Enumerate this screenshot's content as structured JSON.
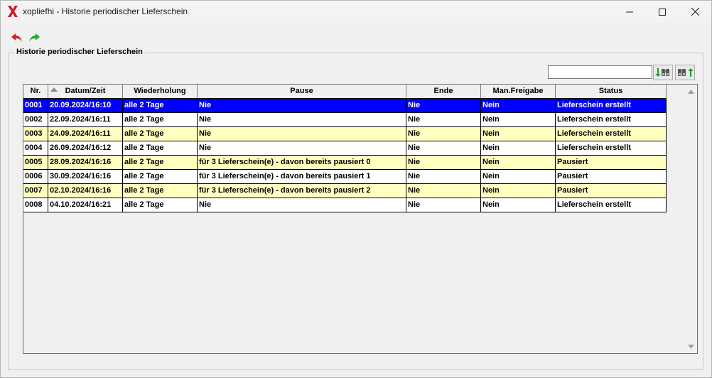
{
  "window": {
    "title": "xopliefhi - Historie periodischer Lieferschein"
  },
  "group": {
    "title": "Historie periodischer Lieferschein"
  },
  "search": {
    "value": "",
    "placeholder": ""
  },
  "table": {
    "headers": [
      "Nr.",
      "Datum/Zeit",
      "Wiederholung",
      "Pause",
      "Ende",
      "Man.Freigabe",
      "Status"
    ],
    "rows": [
      {
        "cells": [
          "0001",
          "20.09.2024/16:10",
          "alle 2 Tage",
          "Nie",
          "Nie",
          "Nein",
          "Lieferschein erstellt"
        ]
      },
      {
        "cells": [
          "0002",
          "22.09.2024/16:11",
          "alle 2 Tage",
          "Nie",
          "Nie",
          "Nein",
          "Lieferschein erstellt"
        ]
      },
      {
        "cells": [
          "0003",
          "24.09.2024/16:11",
          "alle 2 Tage",
          "Nie",
          "Nie",
          "Nein",
          "Lieferschein erstellt"
        ]
      },
      {
        "cells": [
          "0004",
          "26.09.2024/16:12",
          "alle 2 Tage",
          "Nie",
          "Nie",
          "Nein",
          "Lieferschein erstellt"
        ]
      },
      {
        "cells": [
          "0005",
          "28.09.2024/16:16",
          "alle 2 Tage",
          "für 3 Lieferschein(e) - davon bereits pausiert 0",
          "Nie",
          "Nein",
          "Pausiert"
        ]
      },
      {
        "cells": [
          "0006",
          "30.09.2024/16:16",
          "alle 2 Tage",
          "für 3 Lieferschein(e) - davon bereits pausiert 1",
          "Nie",
          "Nein",
          "Pausiert"
        ]
      },
      {
        "cells": [
          "0007",
          "02.10.2024/16:16",
          "alle 2 Tage",
          "für 3 Lieferschein(e) - davon bereits pausiert 2",
          "Nie",
          "Nein",
          "Pausiert"
        ]
      },
      {
        "cells": [
          "0008",
          "04.10.2024/16:21",
          "alle 2 Tage",
          "Nie",
          "Nie",
          "Nein",
          "Lieferschein erstellt"
        ]
      }
    ],
    "selected_row": 0
  },
  "icons": {
    "app": "red-x-app-icon",
    "minimize": "minimize-icon",
    "maximize": "maximize-icon",
    "close": "close-icon",
    "undo": "undo-arrow-icon",
    "redo": "redo-arrow-icon",
    "search_down": "binoculars-down-icon",
    "search_up": "binoculars-up-icon"
  },
  "colors": {
    "selected_row": "#0000ff",
    "alt_row": "#ffffc0",
    "undo": "#cc2222",
    "redo": "#22aa33"
  }
}
